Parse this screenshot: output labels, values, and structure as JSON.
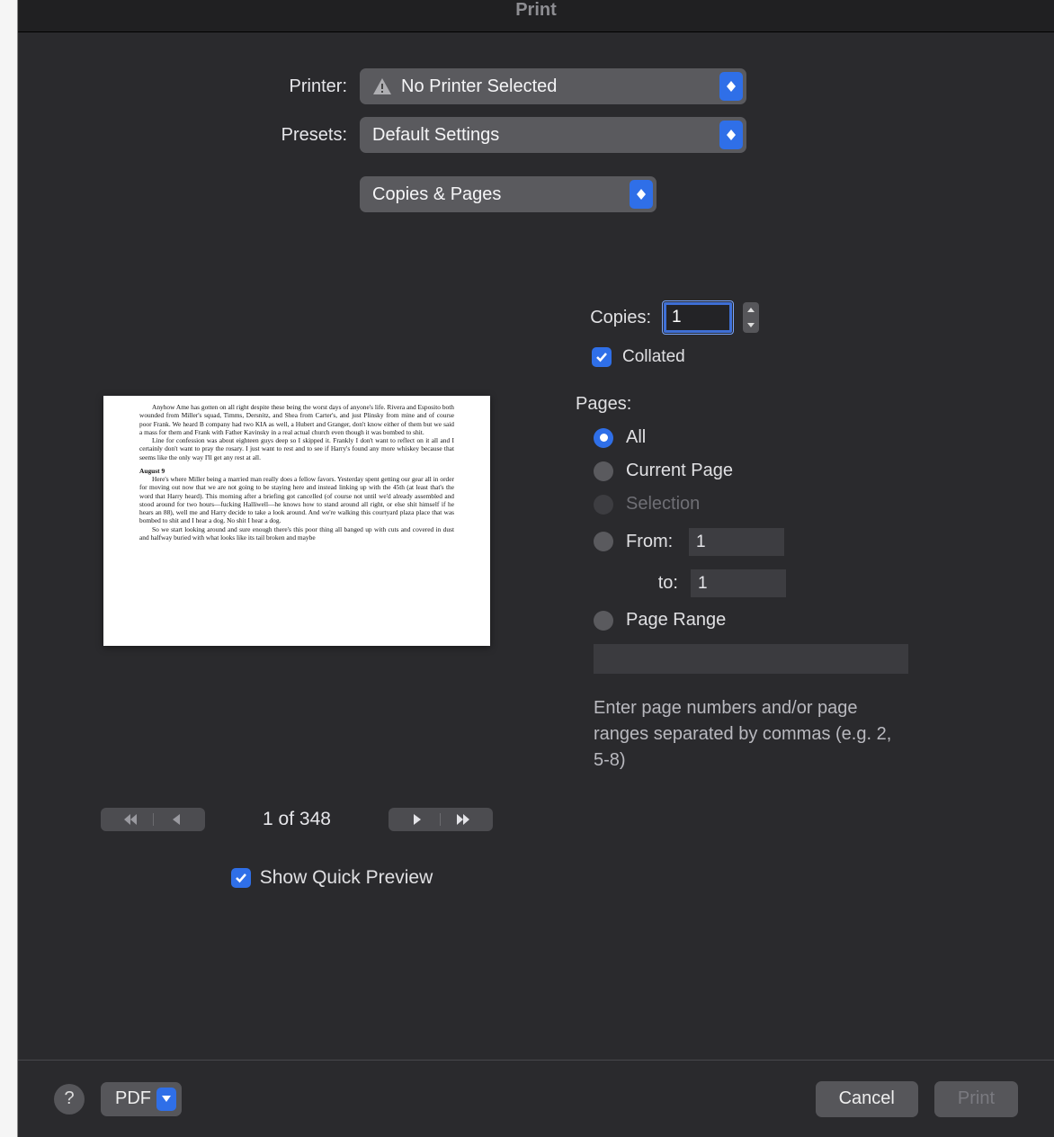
{
  "window": {
    "title": "Print"
  },
  "printer": {
    "label": "Printer:",
    "value": "No Printer Selected"
  },
  "presets": {
    "label": "Presets:",
    "value": "Default Settings"
  },
  "section_select": {
    "value": "Copies & Pages"
  },
  "copies": {
    "label": "Copies:",
    "value": "1",
    "collated_label": "Collated"
  },
  "pages": {
    "header": "Pages:",
    "all": "All",
    "current": "Current Page",
    "selection": "Selection",
    "from_label": "From:",
    "from_value": "1",
    "to_label": "to:",
    "to_value": "1",
    "range_label": "Page Range",
    "range_value": "",
    "hint": "Enter page numbers and/or page ranges separated by commas (e.g. 2, 5-8)"
  },
  "preview": {
    "page_indicator": "1 of 348",
    "show_quick_label": "Show Quick Preview",
    "doc_text": {
      "p1": "Anyhow Ame has gotten on all right despite these being the worst days of anyone's life. Rivera and Esposito both wounded from Miller's squad, Timms, Dersnitz, and Shea from Carter's, and just Plinsky from mine and of course poor Frank. We heard B company had two KIA as well, a Hubert and Granger, don't know either of them but we said a mass for them and Frank with Father Kavinsky in a real actual church even though it was bombed to shit.",
      "p2": "Line for confession was about eighteen guys deep so I skipped it. Frankly I don't want to reflect on it all and I certainly don't want to pray the rosary. I just want to rest and to see if Harry's found any more whiskey because that seems like the only way I'll get any rest at all.",
      "date": "August 9",
      "p3": "Here's where Miller being a married man really does a fellow favors. Yesterday spent getting our gear all in order for moving out now that we are not going to be staying here and instead linking up with the 45th (at least that's the word that Harry heard). This morning after a briefing got cancelled (of course not until we'd already assembled and stood around for two hours—fucking Halliwell—he knows how to stand around all right, or else shit himself if he hears an 88), well me and Harry decide to take a look around. And we're walking this courtyard plaza place that was bombed to shit and I hear a dog. No shit I hear a dog.",
      "p4": "So we start looking around and sure enough there's this poor thing all banged up with cuts and covered in dust and halfway buried with what looks like its tail broken and maybe"
    }
  },
  "footer": {
    "pdf_label": "PDF",
    "cancel": "Cancel",
    "print": "Print"
  }
}
